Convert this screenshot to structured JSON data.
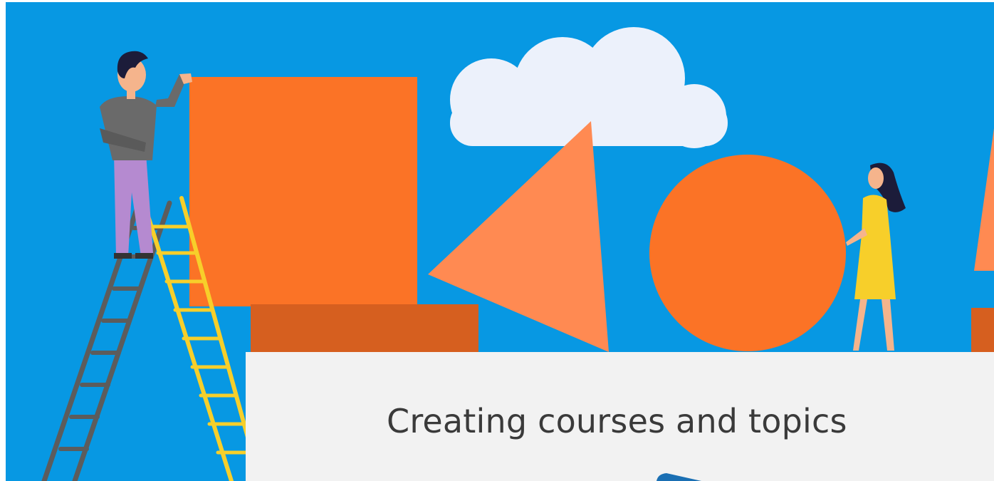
{
  "hero": {
    "title": "Creating courses and topics"
  },
  "colors": {
    "sky": "#0798e3",
    "accent_orange": "#fb7326",
    "dark_orange": "#d65f1f",
    "light_orange": "#ff8a52",
    "cloud": "#ecf1fb",
    "ladder_gray": "#5c5c5c",
    "ladder_yellow": "#f7cf2a",
    "card_bg": "#f2f2f2",
    "title_text": "#3a3a3a"
  }
}
